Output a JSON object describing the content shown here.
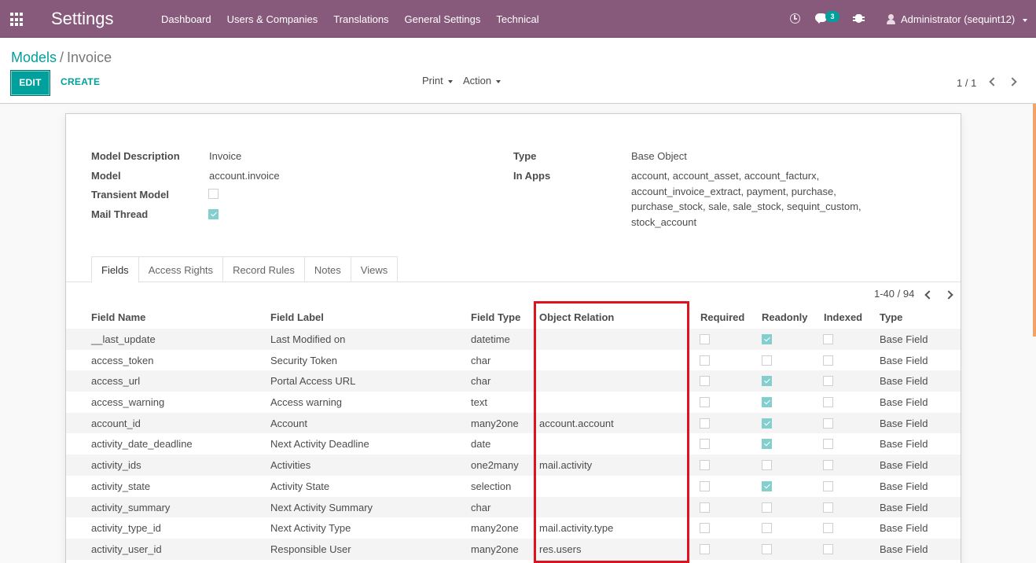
{
  "navbar": {
    "brand": "Settings",
    "menu": [
      "Dashboard",
      "Users & Companies",
      "Translations",
      "General Settings",
      "Technical"
    ],
    "chat_count": "3",
    "user": "Administrator (sequint12)"
  },
  "control_panel": {
    "breadcrumb_parent": "Models",
    "breadcrumb_sep": "/",
    "breadcrumb_current": "Invoice",
    "edit_label": "EDIT",
    "create_label": "CREATE",
    "print_label": "Print",
    "action_label": "Action",
    "pager": "1 / 1"
  },
  "form": {
    "model_description_label": "Model Description",
    "model_description": "Invoice",
    "model_label": "Model",
    "model": "account.invoice",
    "transient_label": "Transient Model",
    "transient": false,
    "mail_thread_label": "Mail Thread",
    "mail_thread": true,
    "type_label": "Type",
    "type": "Base Object",
    "in_apps_label": "In Apps",
    "in_apps": "account, account_asset, account_facturx, account_invoice_extract, payment, purchase, purchase_stock, sale, sale_stock, sequint_custom, stock_account"
  },
  "tabs": [
    "Fields",
    "Access Rights",
    "Record Rules",
    "Notes",
    "Views"
  ],
  "list": {
    "pager": "1-40 / 94",
    "columns": [
      "Field Name",
      "Field Label",
      "Field Type",
      "Object Relation",
      "Required",
      "Readonly",
      "Indexed",
      "Type"
    ],
    "rows": [
      {
        "name": "__last_update",
        "label": "Last Modified on",
        "ftype": "datetime",
        "relation": "",
        "required": false,
        "readonly": true,
        "indexed": false,
        "type": "Base Field"
      },
      {
        "name": "access_token",
        "label": "Security Token",
        "ftype": "char",
        "relation": "",
        "required": false,
        "readonly": false,
        "indexed": false,
        "type": "Base Field"
      },
      {
        "name": "access_url",
        "label": "Portal Access URL",
        "ftype": "char",
        "relation": "",
        "required": false,
        "readonly": true,
        "indexed": false,
        "type": "Base Field"
      },
      {
        "name": "access_warning",
        "label": "Access warning",
        "ftype": "text",
        "relation": "",
        "required": false,
        "readonly": true,
        "indexed": false,
        "type": "Base Field"
      },
      {
        "name": "account_id",
        "label": "Account",
        "ftype": "many2one",
        "relation": "account.account",
        "required": false,
        "readonly": true,
        "indexed": false,
        "type": "Base Field"
      },
      {
        "name": "activity_date_deadline",
        "label": "Next Activity Deadline",
        "ftype": "date",
        "relation": "",
        "required": false,
        "readonly": true,
        "indexed": false,
        "type": "Base Field"
      },
      {
        "name": "activity_ids",
        "label": "Activities",
        "ftype": "one2many",
        "relation": "mail.activity",
        "required": false,
        "readonly": false,
        "indexed": false,
        "type": "Base Field"
      },
      {
        "name": "activity_state",
        "label": "Activity State",
        "ftype": "selection",
        "relation": "",
        "required": false,
        "readonly": true,
        "indexed": false,
        "type": "Base Field"
      },
      {
        "name": "activity_summary",
        "label": "Next Activity Summary",
        "ftype": "char",
        "relation": "",
        "required": false,
        "readonly": false,
        "indexed": false,
        "type": "Base Field"
      },
      {
        "name": "activity_type_id",
        "label": "Next Activity Type",
        "ftype": "many2one",
        "relation": "mail.activity.type",
        "required": false,
        "readonly": false,
        "indexed": false,
        "type": "Base Field"
      },
      {
        "name": "activity_user_id",
        "label": "Responsible User",
        "ftype": "many2one",
        "relation": "res.users",
        "required": false,
        "readonly": false,
        "indexed": false,
        "type": "Base Field"
      }
    ]
  },
  "colors": {
    "navbar": "#875a7b",
    "accent": "#00a09d",
    "highlight_box": "#e0121e"
  }
}
